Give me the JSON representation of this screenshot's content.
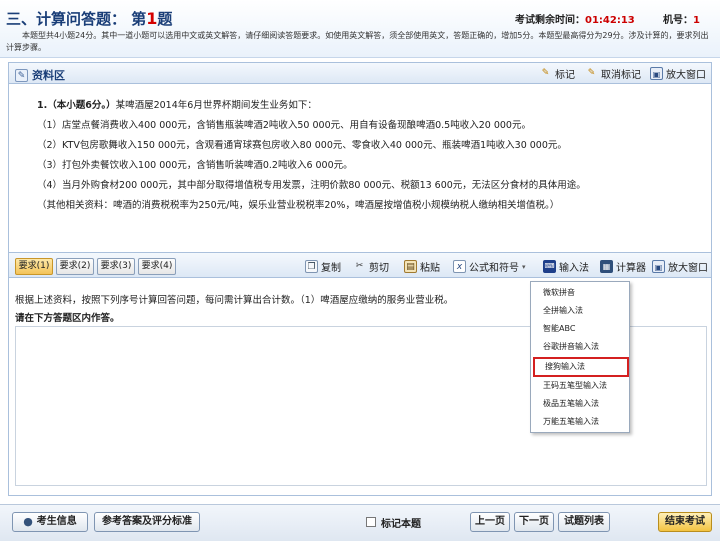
{
  "header": {
    "title_prefix": "三、计算问答题：",
    "title_number_prefix": "第",
    "question_number": "1",
    "title_number_suffix": "题",
    "timer_label": "考试剩余时间：",
    "timer_value": "01:42:13",
    "machine_label": "机号：",
    "machine_value": "1",
    "instructions": "本题型共4小题24分。其中一道小题可以选用中文或英文解答，请仔细阅读答题要求。如使用英文解答，须全部使用英文，答题正确的，增加5分。本题型最高得分为29分。涉及计算的，要求列出计算步骤。"
  },
  "material_panel": {
    "title": "资料区",
    "mark_label": "标记",
    "unmark_label": "取消标记",
    "zoom_label": "放大窗口"
  },
  "material": {
    "q_prefix": "1.（本小题6分。）",
    "q_text": "某啤酒屋2014年6月世界杯期间发生业务如下：",
    "lines": [
      "（1）店堂点餐消费收入400 000元，含销售瓶装啤酒2吨收入50 000元、用自有设备现酿啤酒0.5吨收入20 000元。",
      "（2）KTV包房歌舞收入150 000元，含观看通宵球赛包房收入80 000元、零食收入40 000元、瓶装啤酒1吨收入30 000元。",
      "（3）打包外卖餐饮收入100 000元，含销售听装啤酒0.2吨收入6 000元。",
      "（4）当月外购食材200 000元，其中部分取得增值税专用发票，注明价款80 000元、税额13 600元，无法区分食材的具体用途。",
      "（其他相关资料：啤酒的消费税税率为250元/吨，娱乐业营业税税率20%，啤酒屋按增值税小规模纳税人缴纳相关增值税。）"
    ]
  },
  "requirements": {
    "tabs": [
      "要求(1)",
      "要求(2)",
      "要求(3)",
      "要求(4)"
    ],
    "copy": "复制",
    "cut": "剪切",
    "paste": "粘贴",
    "formula": "公式和符号",
    "ime": "输入法",
    "calculator": "计算器",
    "zoom": "放大窗口"
  },
  "answer": {
    "prompt": "根据上述资料，按照下列序号计算回答问题，每问需计算出合计数。（1）啤酒屋应缴纳的服务业营业税。",
    "heading": "请在下方答题区内作答。"
  },
  "ime_menu": {
    "items": [
      "微软拼音",
      "全拼输入法",
      "智能ABC",
      "谷歌拼音输入法",
      "搜狗输入法",
      "王码五笔型输入法",
      "极品五笔输入法",
      "万能五笔输入法"
    ],
    "selected_index": 4
  },
  "footer": {
    "candidate_info": "考生信息",
    "reference": "参考答案及评分标准",
    "mark_question": "标记本题",
    "prev": "上一页",
    "next": "下一页",
    "question_list": "试题列表",
    "finish": "结束考试"
  },
  "colors": {
    "accent_red": "#d40000",
    "title_blue": "#1a3e78",
    "selection_border": "#d42020"
  }
}
